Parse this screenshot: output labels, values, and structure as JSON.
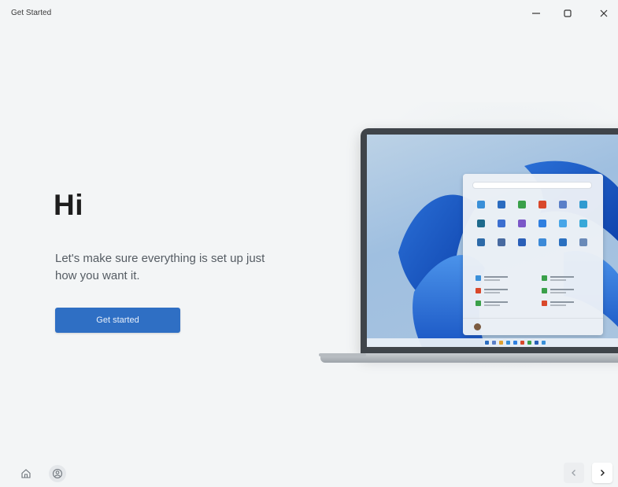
{
  "window": {
    "title": "Get Started",
    "controls": {
      "minimize": "minimize-icon",
      "maximize": "maximize-icon",
      "close": "close-icon"
    }
  },
  "hero": {
    "heading": "Hi",
    "subtitle": "Let's make sure everything is set up just how you want it.",
    "primary_button": "Get started"
  },
  "illustration": {
    "type": "laptop-with-windows-start-menu",
    "colors": {
      "accent": "#2f6fc4",
      "background": "#f3f5f6"
    }
  },
  "footer": {
    "left_icons": [
      "home-icon",
      "account-icon"
    ],
    "right_nav": [
      "chevron-left-icon",
      "chevron-right-icon"
    ]
  }
}
